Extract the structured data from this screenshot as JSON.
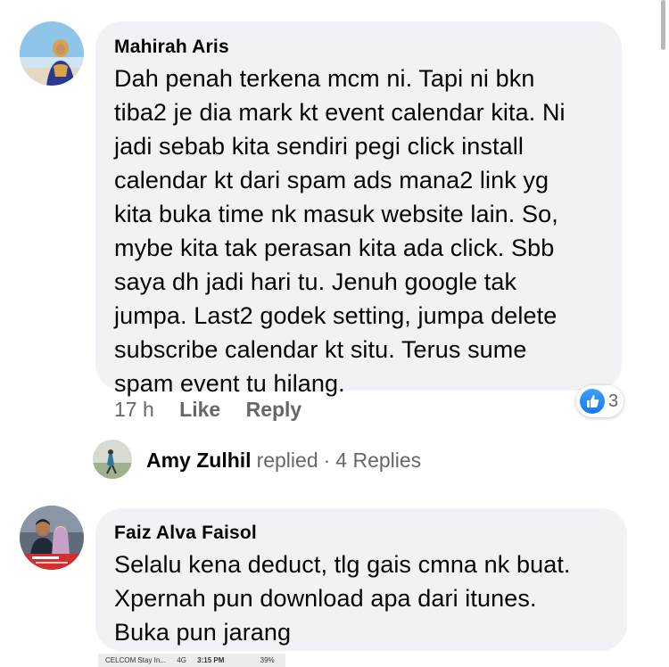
{
  "comments": [
    {
      "author": "Mahirah Aris",
      "lines": [
        "Dah penah terkena mcm ni. Tapi ni bkn",
        "tiba2 je dia mark kt event calendar kita. Ni",
        "jadi sebab kita sendiri pegi click install",
        "calendar kt dari spam ads mana2 link yg",
        "kita buka time nk masuk website lain. So,",
        "mybe kita tak perasan kita ada click. Sbb",
        "saya dh jadi hari tu. Jenuh google tak",
        "jumpa. Last2 godek setting, jumpa delete",
        "subscribe calendar kt situ. Terus sume",
        "spam event tu hilang."
      ],
      "time": "17 h",
      "like_label": "Like",
      "reply_label": "Reply",
      "reaction_icon": "like-icon",
      "reaction_count": "3",
      "replies": {
        "name": "Amy Zulhil",
        "word": "replied",
        "separator": "·",
        "count_label": "4 Replies"
      }
    },
    {
      "author": "Faiz Alva Faisol",
      "lines": [
        "Selalu kena deduct, tlg gais cmna nk buat.",
        "Xpernah pun download apa dari itunes.",
        "Buka pun jarang"
      ]
    }
  ],
  "footer": {
    "carrier": "CELCOM Stay In...",
    "network": "4G",
    "time": "3:15 PM",
    "battery": "39%"
  },
  "colors": {
    "bubble": "#f0f2f5",
    "meta": "#65676b",
    "like_blue": "#1877f2"
  }
}
